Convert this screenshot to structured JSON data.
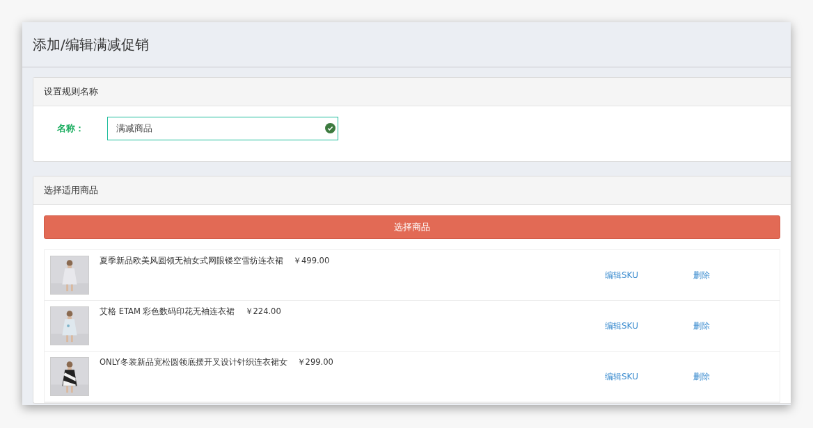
{
  "window": {
    "title": "添加/编辑满减促销"
  },
  "name_section": {
    "title": "设置规则名称",
    "label": "名称：",
    "field": {
      "value": "满减商品",
      "valid": true
    }
  },
  "goods_section": {
    "title": "选择适用商品",
    "select_button": "选择商品",
    "items": [
      {
        "name": "夏季新品欧美风圆领无袖女式网眼镂空雪纺连衣裙",
        "price": "￥499.00",
        "edit_link": "编辑SKU",
        "delete_link": "删除"
      },
      {
        "name": "艾格 ETAM 彩色数码印花无袖连衣裙",
        "price": "￥224.00",
        "edit_link": "编辑SKU",
        "delete_link": "删除"
      },
      {
        "name": "ONLY冬装新品宽松圆领底摆开叉设计针织连衣裙女",
        "price": "￥299.00",
        "edit_link": "编辑SKU",
        "delete_link": "删除"
      }
    ]
  }
}
